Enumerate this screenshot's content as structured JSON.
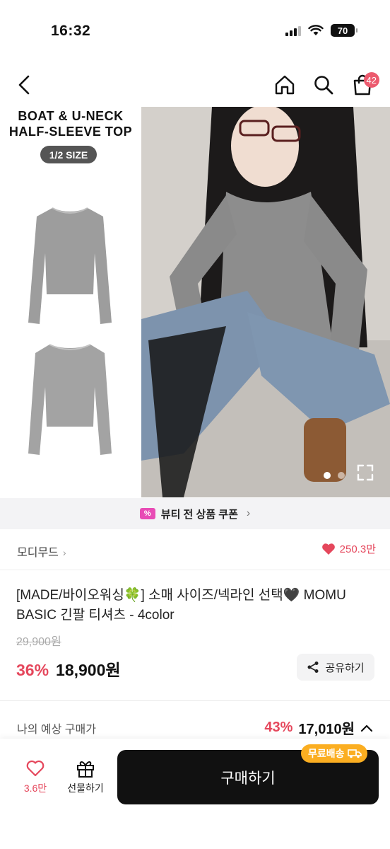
{
  "status_bar": {
    "time": "16:32",
    "battery": "70"
  },
  "nav": {
    "cart_count": "42"
  },
  "hero": {
    "title_line1": "BOAT & U-NECK",
    "title_line2": "HALF-SLEEVE TOP",
    "size_label": "1/2 SIZE",
    "page_count": 2,
    "current_page": 1
  },
  "coupon": {
    "label": "뷰티 전 상품 쿠폰",
    "icon_text": "%"
  },
  "brand": {
    "name": "모디무드",
    "likes": "250.3만"
  },
  "product": {
    "title": "[MADE/바이오워싱🍀] 소매 사이즈/넥라인 선택🖤 MOMU BASIC 긴팔 티셔츠 - 4color",
    "original_price": "29,900원",
    "discount": "36%",
    "price": "18,900원",
    "share_label": "공유하기"
  },
  "my_price": {
    "label": "나의 예상 구매가",
    "discount": "43%",
    "price": "17,010원"
  },
  "bottom_bar": {
    "like_count": "3.6만",
    "gift_label": "선물하기",
    "buy_label": "구매하기",
    "shipping_badge": "무료배송"
  },
  "colors": {
    "accent": "#e5475c",
    "badge": "#fbae21",
    "buy_button": "#111111"
  }
}
